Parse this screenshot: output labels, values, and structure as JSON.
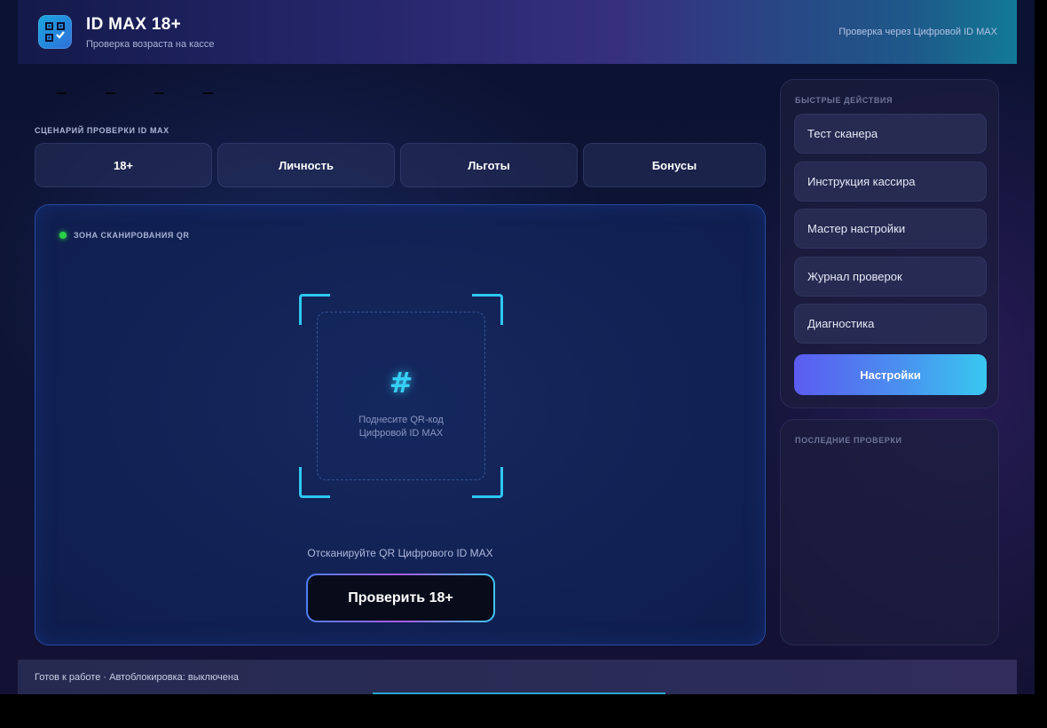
{
  "header": {
    "title": "ID MAX 18+",
    "subtitle": "Проверка возраста на кассе",
    "right_text": "Проверка через Цифровой ID MAX",
    "logo_icon": "qr-shield-icon"
  },
  "scenario": {
    "label": "СЦЕНАРИЙ ПРОВЕРКИ ID MAX",
    "tabs": [
      {
        "label": "18+"
      },
      {
        "label": "Личность"
      },
      {
        "label": "Льготы"
      },
      {
        "label": "Бонусы"
      }
    ]
  },
  "scan_zone": {
    "label": "ЗОНА СКАНИРОВАНИЯ QR",
    "status_color": "#2bd34a",
    "icon": "hash-icon",
    "hint_line1": "Поднесите QR-код",
    "hint_line2": "Цифровой ID MAX",
    "message": "Отсканируйте QR Цифрового ID MAX",
    "verify_button": "Проверить 18+"
  },
  "quick_actions": {
    "title": "БЫСТРЫЕ ДЕЙСТВИЯ",
    "items": [
      {
        "label": "Тест сканера"
      },
      {
        "label": "Инструкция кассира"
      },
      {
        "label": "Мастер настройки"
      },
      {
        "label": "Журнал проверок"
      },
      {
        "label": "Диагностика"
      }
    ],
    "settings_button": "Настройки"
  },
  "recent_checks": {
    "title": "ПОСЛЕДНИЕ ПРОВЕРКИ"
  },
  "footer": {
    "status": "Готов к работе · Автоблокировка: выключена"
  },
  "colors": {
    "accent_cyan": "#2fc7f2",
    "accent_purple": "#a85cf0",
    "accent_blue": "#4f7df5"
  }
}
